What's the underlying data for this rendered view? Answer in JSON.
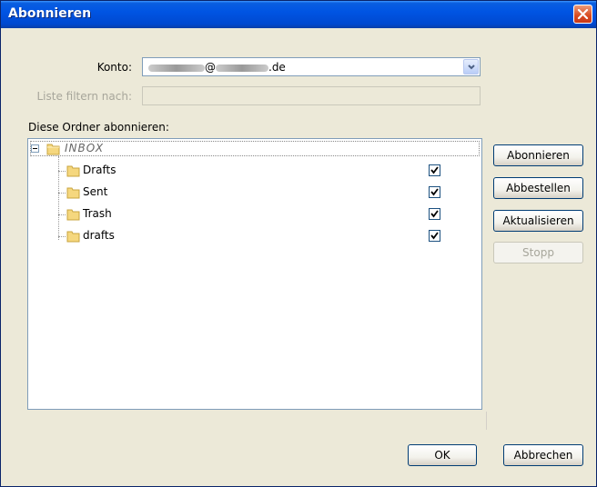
{
  "window": {
    "title": "Abonnieren"
  },
  "account": {
    "label": "Konto:",
    "value_prefix": "@",
    "value_suffix": ".de"
  },
  "filter": {
    "label": "Liste filtern nach:",
    "value": ""
  },
  "list": {
    "heading": "Diese Ordner abonnieren:",
    "root": {
      "name": "INBOX"
    },
    "folders": [
      {
        "name": "Drafts",
        "subscribed": true
      },
      {
        "name": "Sent",
        "subscribed": true
      },
      {
        "name": "Trash",
        "subscribed": true
      },
      {
        "name": "drafts",
        "subscribed": true
      }
    ]
  },
  "side_buttons": {
    "subscribe": "Abonnieren",
    "unsubscribe": "Abbestellen",
    "refresh": "Aktualisieren",
    "stop": "Stopp"
  },
  "footer": {
    "ok": "OK",
    "cancel": "Abbrechen"
  },
  "colors": {
    "titlebar": "#0054e3",
    "face": "#ece9d8",
    "close": "#d8491f"
  }
}
